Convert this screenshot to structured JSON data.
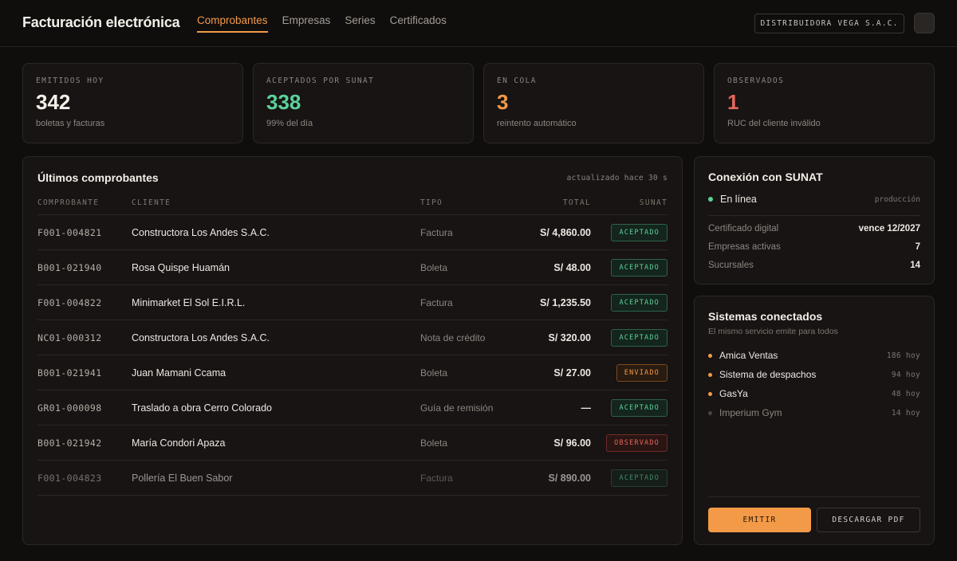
{
  "header": {
    "title": "Facturación electrónica",
    "tabs": [
      "Comprobantes",
      "Empresas",
      "Series",
      "Certificados"
    ],
    "company": "DISTRIBUIDORA VEGA S.A.C."
  },
  "stats": [
    {
      "label": "EMITIDOS HOY",
      "value": "342",
      "sub": "boletas y facturas",
      "color": "#f3efe9"
    },
    {
      "label": "ACEPTADOS POR SUNAT",
      "value": "338",
      "sub": "99% del día",
      "color": "#5bd29a"
    },
    {
      "label": "EN COLA",
      "value": "3",
      "sub": "reintento automático",
      "color": "#f29a48"
    },
    {
      "label": "OBSERVADOS",
      "value": "1",
      "sub": "RUC del cliente inválido",
      "color": "#e4675e"
    }
  ],
  "table": {
    "title": "Últimos comprobantes",
    "updated": "actualizado hace 30 s",
    "columns": [
      "COMPROBANTE",
      "CLIENTE",
      "TIPO",
      "TOTAL",
      "SUNAT"
    ],
    "rows": [
      {
        "num": "F001-004821",
        "cliente": "Constructora Los Andes S.A.C.",
        "tipo": "Factura",
        "total": "S/ 4,860.00",
        "status": "ACEPTADO"
      },
      {
        "num": "B001-021940",
        "cliente": "Rosa Quispe Huamán",
        "tipo": "Boleta",
        "total": "S/ 48.00",
        "status": "ACEPTADO"
      },
      {
        "num": "F001-004822",
        "cliente": "Minimarket El Sol E.I.R.L.",
        "tipo": "Factura",
        "total": "S/ 1,235.50",
        "status": "ACEPTADO"
      },
      {
        "num": "NC01-000312",
        "cliente": "Constructora Los Andes S.A.C.",
        "tipo": "Nota de crédito",
        "total": "S/ 320.00",
        "status": "ACEPTADO"
      },
      {
        "num": "B001-021941",
        "cliente": "Juan Mamani Ccama",
        "tipo": "Boleta",
        "total": "S/ 27.00",
        "status": "ENVIADO"
      },
      {
        "num": "GR01-000098",
        "cliente": "Traslado a obra Cerro Colorado",
        "tipo": "Guía de remisión",
        "total": "—",
        "status": "ACEPTADO"
      },
      {
        "num": "B001-021942",
        "cliente": "María Condori Apaza",
        "tipo": "Boleta",
        "total": "S/ 96.00",
        "status": "OBSERVADO"
      },
      {
        "num": "F001-004823",
        "cliente": "Pollería El Buen Sabor",
        "tipo": "Factura",
        "total": "S/ 890.00",
        "status": "ACEPTADO"
      }
    ]
  },
  "sunat": {
    "title": "Conexión con SUNAT",
    "status": "En línea",
    "env": "producción",
    "items": [
      {
        "k": "Certificado digital",
        "v": "vence 12/2027"
      },
      {
        "k": "Empresas activas",
        "v": "7"
      },
      {
        "k": "Sucursales",
        "v": "14"
      }
    ]
  },
  "systems": {
    "title": "Sistemas conectados",
    "subtitle": "El mismo servicio emite para todos",
    "items": [
      {
        "name": "Amica Ventas",
        "count": "186 hoy"
      },
      {
        "name": "Sistema de despachos",
        "count": "94 hoy"
      },
      {
        "name": "GasYa",
        "count": "48 hoy"
      },
      {
        "name": "Imperium Gym",
        "count": "14 hoy"
      }
    ],
    "emit_label": "EMITIR",
    "download_label": "DESCARGAR PDF"
  },
  "colors": {
    "accent": "#f29a48",
    "ok": "#5bd29a",
    "error": "#e4675e",
    "background": "#100e0d"
  }
}
